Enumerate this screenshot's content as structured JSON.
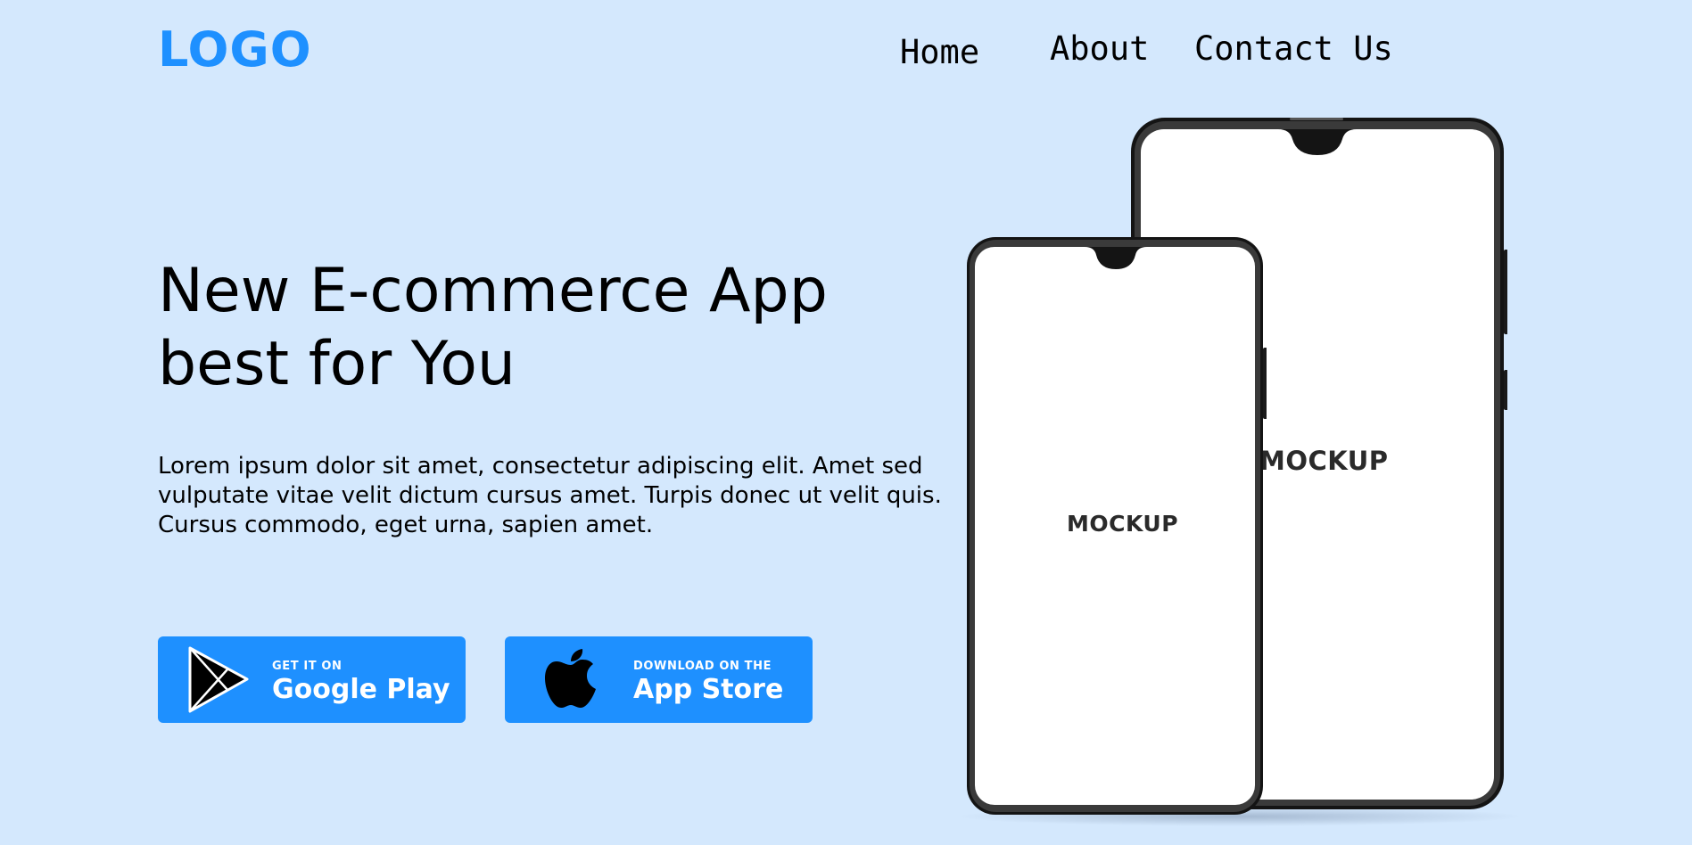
{
  "header": {
    "logo": "LOGO",
    "nav": {
      "home": "Home",
      "about": "About",
      "contact": "Contact Us"
    }
  },
  "hero": {
    "headline_line1": "New E-commerce App",
    "headline_line2": "best for You",
    "description": "Lorem ipsum dolor sit amet, consectetur adipiscing elit. Amet sed vulputate vitae velit dictum cursus amet. Turpis donec ut velit quis. Cursus commodo, eget urna, sapien amet."
  },
  "buttons": {
    "google": {
      "small": "GET IT ON",
      "big": "Google Play",
      "icon": "google-play-icon"
    },
    "apple": {
      "small": "DOWNLOAD ON THE",
      "big": "App Store",
      "icon": "apple-icon"
    }
  },
  "mockups": {
    "back_label": "MOCKUP",
    "front_label": "MOCKUP"
  },
  "colors": {
    "background": "#d4e8fd",
    "accent": "#1e90ff",
    "text": "#000000"
  }
}
